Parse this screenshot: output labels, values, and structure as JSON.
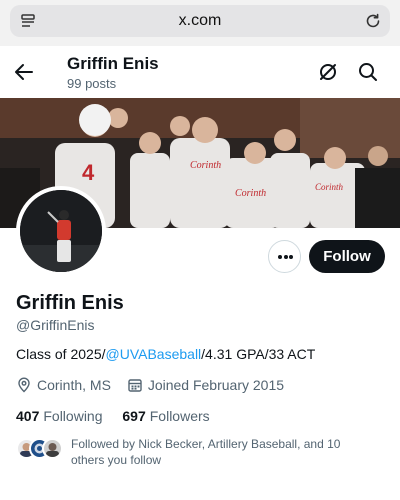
{
  "browser": {
    "url": "x.com"
  },
  "header": {
    "name": "Griffin Enis",
    "posts": "99 posts"
  },
  "profile": {
    "display_name": "Griffin Enis",
    "handle": "@GriffinEnis",
    "bio_prefix": "Class of 2025/",
    "bio_mention": "@UVABaseball",
    "bio_suffix": "/4.31 GPA/33 ACT",
    "location": "Corinth, MS",
    "joined": "Joined February 2015",
    "following_count": "407",
    "following_label": "Following",
    "followers_count": "697",
    "followers_label": "Followers",
    "followed_by": "Followed by Nick Becker, Artillery Baseball, and 10 others you follow"
  },
  "actions": {
    "follow_label": "Follow"
  },
  "icons": {
    "tabs": "tabs-icon",
    "reload": "reload-icon",
    "back": "back-arrow-icon",
    "mute": "mute-icon",
    "search": "search-icon",
    "more": "more-icon",
    "location": "location-pin-icon",
    "calendar": "calendar-icon"
  },
  "colors": {
    "link": "#1d9bf0",
    "follow_button": "#0f1419",
    "secondary_text": "#536471"
  }
}
